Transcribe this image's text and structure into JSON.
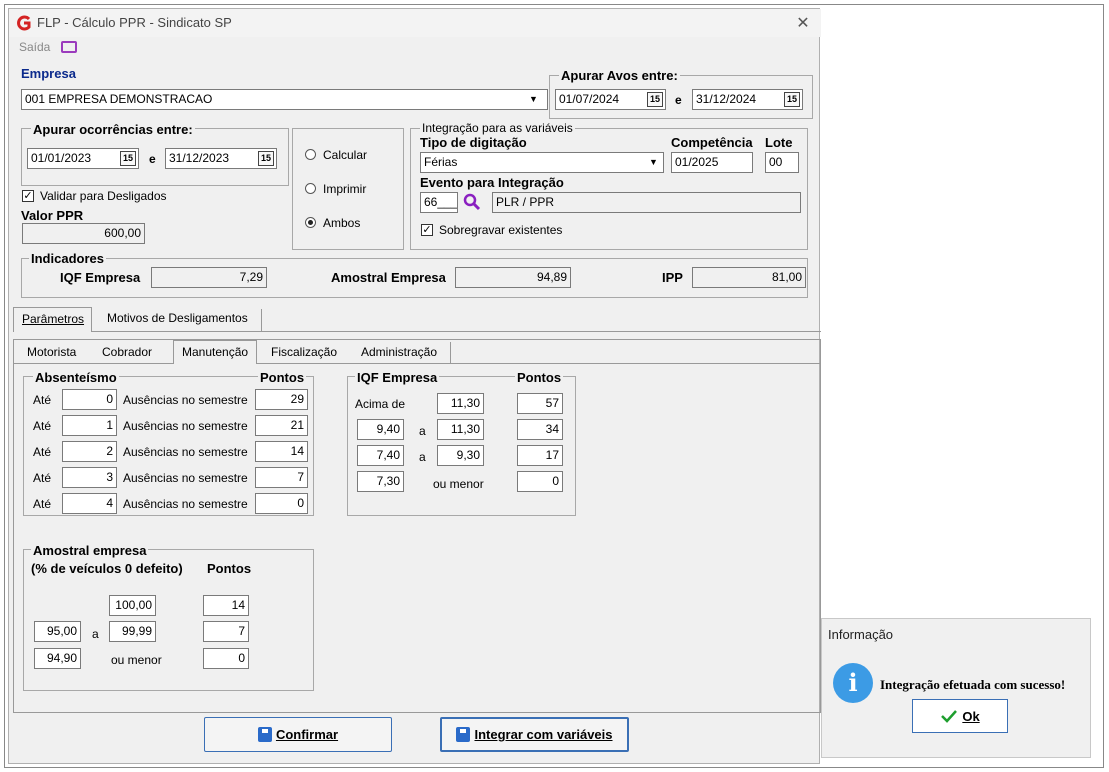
{
  "window": {
    "title": "FLP - Cálculo PPR - Sindicato SP",
    "close": "✕",
    "menu_saida": "Saída"
  },
  "empresa": {
    "label": "Empresa",
    "value": "001 EMPRESA DEMONSTRACAO"
  },
  "avos": {
    "label": "Apurar Avos entre:",
    "start": "01/07/2024",
    "sep": "e",
    "end": "31/12/2024"
  },
  "ocorrencias": {
    "label": "Apurar ocorrências entre:",
    "start": "01/01/2023",
    "sep": "e",
    "end": "31/12/2023"
  },
  "validar": {
    "label": "Validar para Desligados",
    "checked": "✓"
  },
  "valor_ppr": {
    "label": "Valor PPR",
    "value": "600,00"
  },
  "acao": {
    "calcular": "Calcular",
    "imprimir": "Imprimir",
    "ambos": "Ambos"
  },
  "integracao": {
    "group_label": "Integração para as variáveis",
    "tipo_label": "Tipo de digitação",
    "tipo_value": "Férias",
    "competencia_label": "Competência",
    "competencia_value": "01/2025",
    "lote_label": "Lote",
    "lote_value": "00",
    "evento_label": "Evento para Integração",
    "evento_code": "66___",
    "evento_desc": "PLR / PPR",
    "sobregravar_label": "Sobregravar existentes",
    "sobregravar_checked": "✓"
  },
  "indicadores": {
    "label": "Indicadores",
    "iqf_label": "IQF Empresa",
    "iqf_value": "7,29",
    "amostral_label": "Amostral Empresa",
    "amostral_value": "94,89",
    "ipp_label": "IPP",
    "ipp_value": "81,00"
  },
  "tabs_main": [
    "Parâmetros",
    "Motivos de Desligamentos"
  ],
  "tabs_sub": [
    "Motorista",
    "Cobrador",
    "Manutenção",
    "Fiscalização",
    "Administração"
  ],
  "absenteismo": {
    "label": "Absenteísmo",
    "pontos_label": "Pontos",
    "rows": [
      {
        "ate": "Até",
        "valor": "0",
        "desc": "Ausências no semestre",
        "pontos": "29"
      },
      {
        "ate": "Até",
        "valor": "1",
        "desc": "Ausências no semestre",
        "pontos": "21"
      },
      {
        "ate": "Até",
        "valor": "2",
        "desc": "Ausências no semestre",
        "pontos": "14"
      },
      {
        "ate": "Até",
        "valor": "3",
        "desc": "Ausências no semestre",
        "pontos": "7"
      },
      {
        "ate": "Até",
        "valor": "4",
        "desc": "Ausências no semestre",
        "pontos": "0"
      }
    ]
  },
  "iqf": {
    "label": "IQF Empresa",
    "pontos_label": "Pontos",
    "acima_label": "Acima de",
    "acima_value": "11,30",
    "acima_pontos": "57",
    "r1_from": "9,40",
    "r1_a": "a",
    "r1_to": "11,30",
    "r1_pontos": "34",
    "r2_from": "7,40",
    "r2_a": "a",
    "r2_to": "9,30",
    "r2_pontos": "17",
    "menor_value": "7,30",
    "menor_label": "ou menor",
    "menor_pontos": "0"
  },
  "amostral": {
    "label": "Amostral empresa",
    "sub_label": "(% de veículos 0 defeito)",
    "pontos_label": "Pontos",
    "top_value": "100,00",
    "top_pontos": "14",
    "r1_from": "95,00",
    "r1_a": "a",
    "r1_to": "99,99",
    "r1_pontos": "7",
    "menor_value": "94,90",
    "menor_label": "ou menor",
    "menor_pontos": "0"
  },
  "buttons": {
    "confirmar": "Confirmar",
    "integrar": "Integrar com variáveis"
  },
  "dialog": {
    "title": "Informação",
    "message": "Integração efetuada com sucesso!",
    "ok": "Ok",
    "icon": "i"
  }
}
